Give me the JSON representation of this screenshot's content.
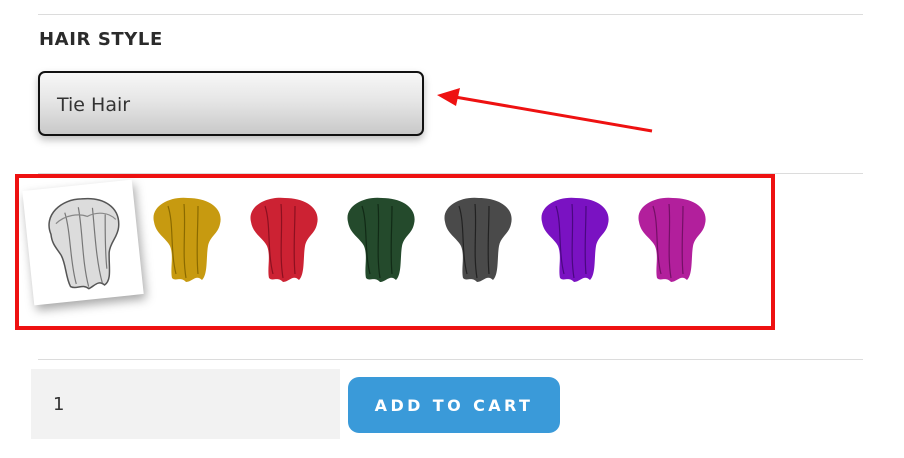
{
  "hair_style": {
    "label": "HAIR STYLE",
    "selected_value": "Tie Hair",
    "swatches": [
      {
        "icon": "hair-white-icon",
        "color": "#d8d8d8",
        "selected": true
      },
      {
        "icon": "hair-gold-icon",
        "color": "#c79a10",
        "selected": false
      },
      {
        "icon": "hair-red-icon",
        "color": "#cc2233",
        "selected": false
      },
      {
        "icon": "hair-dark-green-icon",
        "color": "#244a2c",
        "selected": false
      },
      {
        "icon": "hair-dark-gray-icon",
        "color": "#4a4a4a",
        "selected": false
      },
      {
        "icon": "hair-purple-icon",
        "color": "#7a12c2",
        "selected": false
      },
      {
        "icon": "hair-magenta-icon",
        "color": "#b21f9c",
        "selected": false
      }
    ]
  },
  "cart": {
    "quantity": "1",
    "add_label": "ADD TO CART",
    "button_color": "#3a9ad9"
  },
  "annotation": {
    "color": "#ee1111"
  }
}
